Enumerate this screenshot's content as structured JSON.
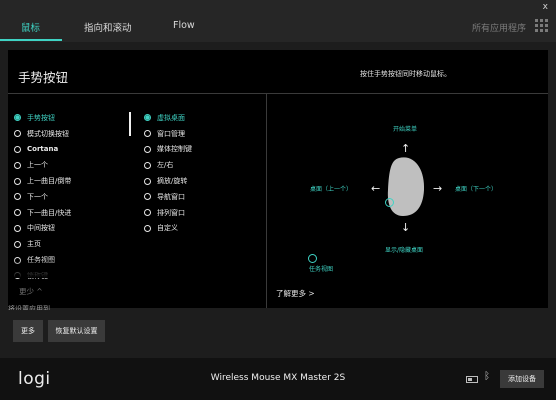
{
  "tabs": [
    {
      "label": "鼠标"
    },
    {
      "label": "指向和滚动"
    },
    {
      "label": "Flow"
    }
  ],
  "header": {
    "all_apps": "所有应用程序",
    "close_symbol": "x"
  },
  "panel": {
    "title": "手势按钮",
    "hint": "按住手势按钮同时移动鼠标。",
    "left_options": [
      {
        "label": "手势按钮",
        "selected": true
      },
      {
        "label": "模式切换按钮"
      },
      {
        "label": "Cortana"
      },
      {
        "label": "上一个"
      },
      {
        "label": "上一曲目/倒带"
      },
      {
        "label": "下一个"
      },
      {
        "label": "下一曲目/快进"
      },
      {
        "label": "中间按钮"
      },
      {
        "label": "主页"
      },
      {
        "label": "任务视图"
      },
      {
        "label": "锁称键"
      }
    ],
    "right_options": [
      {
        "label": "虚拟桌面",
        "selected": true
      },
      {
        "label": "窗口管理"
      },
      {
        "label": "媒体控制键"
      },
      {
        "label": "左/右"
      },
      {
        "label": "摘放/旋转"
      },
      {
        "label": "导航窗口"
      },
      {
        "label": "排列窗口"
      },
      {
        "label": "自定义"
      }
    ],
    "more_toggle": "更少 ^",
    "learn_more": "了解更多 >"
  },
  "gestures": {
    "up": "开始菜单",
    "left": "桌面（上一个）",
    "right": "桌面（下一个）",
    "down": "显示/隐藏桌面",
    "click": "任务视图"
  },
  "below": {
    "cutoff_text": "将设置应用到",
    "more_button": "更多",
    "restore_button": "恢复默认设置"
  },
  "footer": {
    "logo": "logi",
    "device_name": "Wireless Mouse MX Master 2S",
    "bluetooth_symbol": "ᛒ",
    "add_device": "添加设备"
  },
  "colors": {
    "accent": "#3fd3c4",
    "background": "#1d1d1d",
    "panel": "#000000"
  }
}
